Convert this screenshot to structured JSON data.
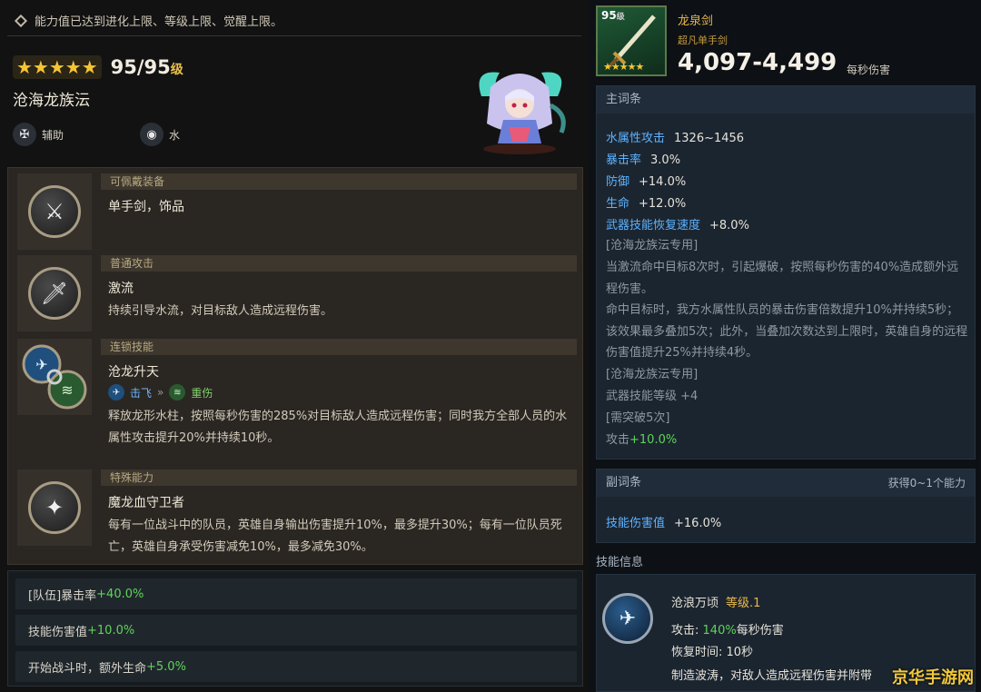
{
  "left": {
    "notice": "能力值已达到进化上限、等级上限、觉醒上限。",
    "hero": {
      "stars": "★★★★★",
      "level": "95/95",
      "level_unit": "级",
      "name": "沧海龙族沄",
      "role": "辅助",
      "element": "水",
      "role_icon": "support-crest-icon",
      "element_icon": "water-drop-icon"
    },
    "skills": [
      {
        "header": "可佩戴装备",
        "title": "单手剑，饰品",
        "icon": "sword-shield-icon"
      },
      {
        "header": "普通攻击",
        "title": "激流",
        "desc": "持续引导水流，对目标敌人造成远程伤害。",
        "icon": "blade-icon"
      },
      {
        "header": "连锁技能",
        "title": "沧龙升天",
        "chain_from": "击飞",
        "chain_to": "重伤",
        "desc": "释放龙形水柱，按照每秒伤害的285%对目标敌人造成远程伤害；同时我方全部人员的水属性攻击提升20%并持续10秒。"
      },
      {
        "header": "特殊能力",
        "title": "魔龙血守卫者",
        "desc": "每有一位战斗中的队员，英雄自身输出伤害提升10%，最多提升30%；每有一位队员死亡，英雄自身承受伤害减免10%，最多减免30%。",
        "icon": "sparkle-icon"
      }
    ],
    "bonuses": [
      {
        "label": "[队伍]暴击率",
        "value": "+40.0%"
      },
      {
        "label": "技能伤害值",
        "value": "+10.0%"
      },
      {
        "label": "开始战斗时，额外生命",
        "value": "+5.0%"
      }
    ]
  },
  "weapon": {
    "level": "95",
    "level_unit": "级",
    "stars": "★★★★★",
    "name": "龙泉剑",
    "type": "超凡单手剑",
    "damage": "4,097-4,499",
    "damage_label": "每秒伤害",
    "main_title": "主词条",
    "stats": [
      {
        "k": "水属性攻击",
        "v": "1326~1456"
      },
      {
        "k": "暴击率",
        "v": "3.0%"
      },
      {
        "k": "防御",
        "v": "+14.0%"
      },
      {
        "k": "生命",
        "v": "+12.0%"
      },
      {
        "k": "武器技能恢复速度",
        "v": "+8.0%"
      }
    ],
    "exclusive_1": "[沧海龙族沄专用]",
    "exclusive_1_text": "当激流命中目标8次时，引起爆破，按照每秒伤害的40%造成额外远程伤害。\n命中目标时，我方水属性队员的暴击伤害倍数提升10%并持续5秒；该效果最多叠加5次；此外，当叠加次数达到上限时，英雄自身的远程伤害值提升25%并持续4秒。",
    "exclusive_2": "[沧海龙族沄专用]",
    "weapon_skill_lv": "武器技能等级 +4",
    "breakthrough": "[需突破5次]",
    "attack_label": "攻击",
    "attack_value": "+10.0%",
    "sub_title": "副词条",
    "sub_range": "获得0~1个能力",
    "sub_stat_k": "技能伤害值",
    "sub_stat_v": "+16.0%"
  },
  "skill_info": {
    "title": "技能信息",
    "name": "沧浪万顷",
    "level": "等级.1",
    "attack_label": "攻击:",
    "attack_pct": "140%",
    "attack_suffix": "每秒伤害",
    "cooldown": "恢复时间: 10秒",
    "desc": "制造波涛，对敌人造成远程伤害并附带"
  },
  "watermark": "京华手游网"
}
